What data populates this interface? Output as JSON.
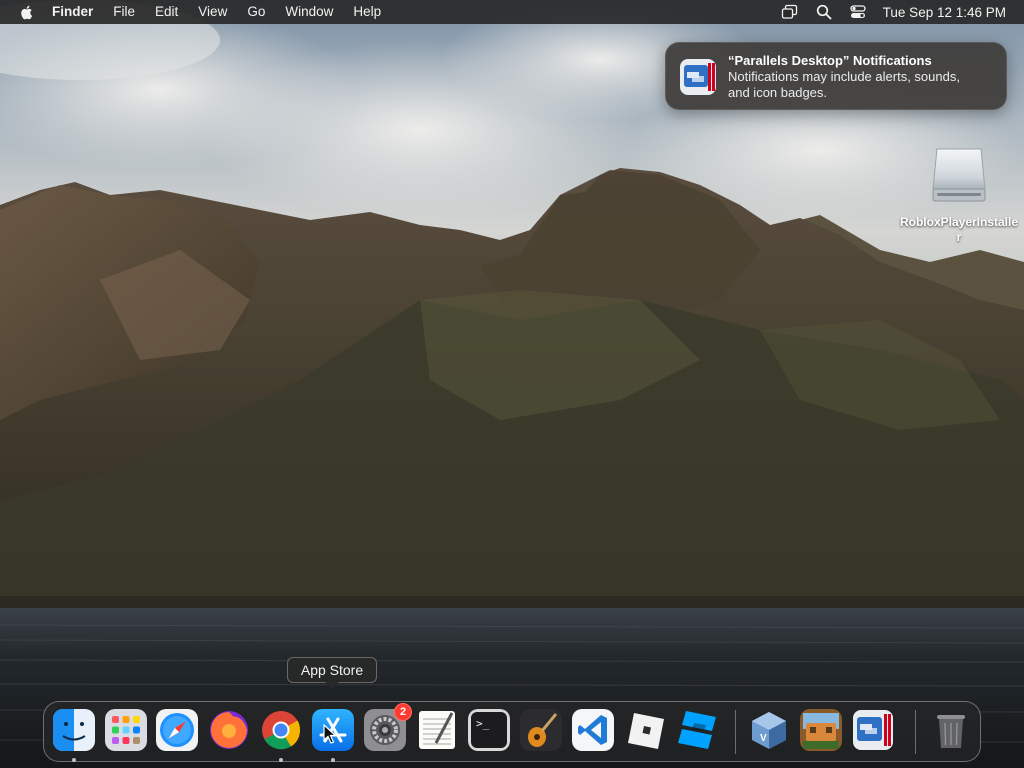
{
  "menubar": {
    "app_name": "Finder",
    "menus": [
      "File",
      "Edit",
      "View",
      "Go",
      "Window",
      "Help"
    ],
    "clock": "Tue Sep 12  1:46 PM",
    "status_icons": [
      "screen-mirroring-icon",
      "spotlight-search-icon",
      "control-center-icon"
    ]
  },
  "notification": {
    "title": "“Parallels Desktop” Notifications",
    "body_line1": "Notifications may include alerts, sounds,",
    "body_line2": "and icon badges.",
    "icon": "parallels-desktop-icon"
  },
  "desktop": {
    "items": [
      {
        "label": "RobloxPlayerInstaller",
        "icon": "disk-image-icon"
      }
    ]
  },
  "tooltip": {
    "text": "App Store"
  },
  "dock": {
    "items": [
      {
        "name": "Finder",
        "icon": "finder-icon",
        "running": true
      },
      {
        "name": "Launchpad",
        "icon": "launchpad-icon",
        "running": false
      },
      {
        "name": "Safari",
        "icon": "safari-icon",
        "running": false
      },
      {
        "name": "Firefox",
        "icon": "firefox-icon",
        "running": false
      },
      {
        "name": "Google Chrome",
        "icon": "chrome-icon",
        "running": true
      },
      {
        "name": "App Store",
        "icon": "app-store-icon",
        "running": true
      },
      {
        "name": "System Settings",
        "icon": "system-settings-icon",
        "running": false,
        "badge": "2"
      },
      {
        "name": "TextEdit",
        "icon": "textedit-icon",
        "running": false
      },
      {
        "name": "Terminal",
        "icon": "terminal-icon",
        "running": false
      },
      {
        "name": "GarageBand",
        "icon": "garageband-icon",
        "running": false
      },
      {
        "name": "Visual Studio Code",
        "icon": "vscode-icon",
        "running": false
      },
      {
        "name": "Roblox",
        "icon": "roblox-icon",
        "running": false
      },
      {
        "name": "Roblox Studio",
        "icon": "roblox-studio-icon",
        "running": false
      },
      {
        "name": "VirtualBox",
        "icon": "virtualbox-icon",
        "running": false
      },
      {
        "name": "Game",
        "icon": "game-icon",
        "running": false
      },
      {
        "name": "Parallels Desktop",
        "icon": "parallels-desktop-icon",
        "running": false
      },
      {
        "name": "Trash",
        "icon": "trash-icon",
        "running": false
      }
    ]
  }
}
